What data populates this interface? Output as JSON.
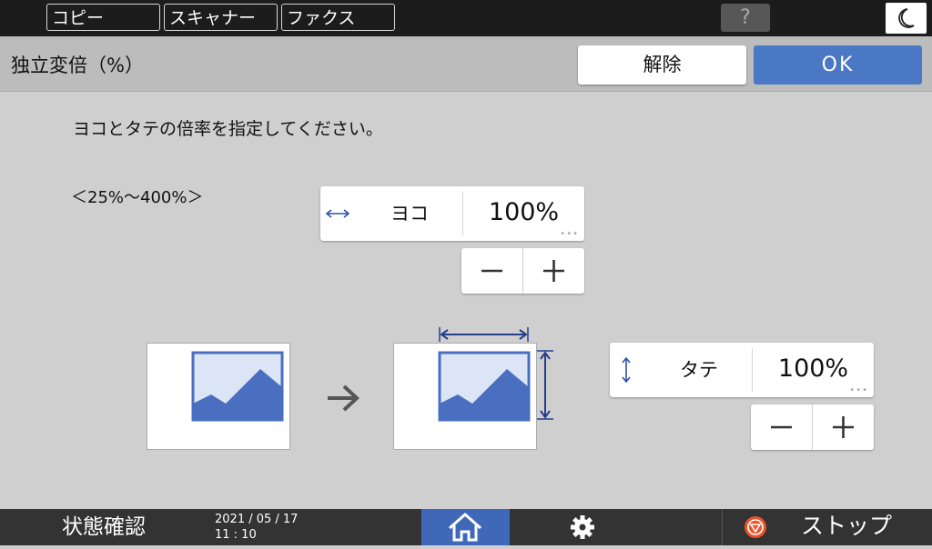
{
  "top_tabs": [
    {
      "label": "コピー"
    },
    {
      "label": "スキャナー"
    },
    {
      "label": "ファクス"
    }
  ],
  "help_label": "?",
  "header": {
    "title": "独立変倍（%）",
    "cancel_label": "解除",
    "ok_label": "OK"
  },
  "main": {
    "instruction": "ヨコとタテの倍率を指定してください。",
    "range": "＜25%〜400%＞",
    "horizontal": {
      "label": "ヨコ",
      "value": "100%"
    },
    "vertical": {
      "label": "タテ",
      "value": "100%"
    }
  },
  "bottom": {
    "status_label": "状態確認",
    "date": "2021 / 05 / 17",
    "time": "11 : 10",
    "stop_label": "ストップ"
  },
  "colors": {
    "accent": "#4a78c4",
    "image_fill": "#4a6fc0",
    "image_bg": "#dce5f5",
    "stop_icon": "#e8542a"
  }
}
